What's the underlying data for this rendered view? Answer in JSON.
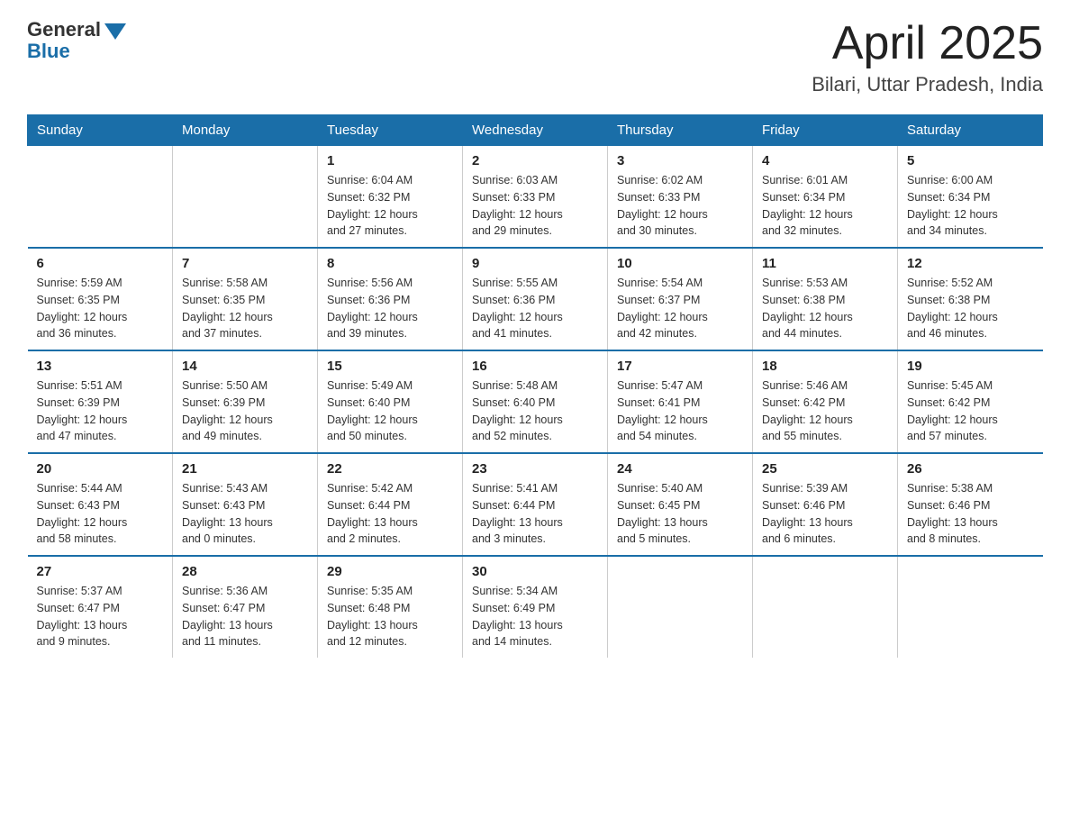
{
  "header": {
    "logo_general": "General",
    "logo_blue": "Blue",
    "title": "April 2025",
    "subtitle": "Bilari, Uttar Pradesh, India"
  },
  "days_of_week": [
    "Sunday",
    "Monday",
    "Tuesday",
    "Wednesday",
    "Thursday",
    "Friday",
    "Saturday"
  ],
  "weeks": [
    [
      {
        "day": "",
        "info": ""
      },
      {
        "day": "",
        "info": ""
      },
      {
        "day": "1",
        "info": "Sunrise: 6:04 AM\nSunset: 6:32 PM\nDaylight: 12 hours\nand 27 minutes."
      },
      {
        "day": "2",
        "info": "Sunrise: 6:03 AM\nSunset: 6:33 PM\nDaylight: 12 hours\nand 29 minutes."
      },
      {
        "day": "3",
        "info": "Sunrise: 6:02 AM\nSunset: 6:33 PM\nDaylight: 12 hours\nand 30 minutes."
      },
      {
        "day": "4",
        "info": "Sunrise: 6:01 AM\nSunset: 6:34 PM\nDaylight: 12 hours\nand 32 minutes."
      },
      {
        "day": "5",
        "info": "Sunrise: 6:00 AM\nSunset: 6:34 PM\nDaylight: 12 hours\nand 34 minutes."
      }
    ],
    [
      {
        "day": "6",
        "info": "Sunrise: 5:59 AM\nSunset: 6:35 PM\nDaylight: 12 hours\nand 36 minutes."
      },
      {
        "day": "7",
        "info": "Sunrise: 5:58 AM\nSunset: 6:35 PM\nDaylight: 12 hours\nand 37 minutes."
      },
      {
        "day": "8",
        "info": "Sunrise: 5:56 AM\nSunset: 6:36 PM\nDaylight: 12 hours\nand 39 minutes."
      },
      {
        "day": "9",
        "info": "Sunrise: 5:55 AM\nSunset: 6:36 PM\nDaylight: 12 hours\nand 41 minutes."
      },
      {
        "day": "10",
        "info": "Sunrise: 5:54 AM\nSunset: 6:37 PM\nDaylight: 12 hours\nand 42 minutes."
      },
      {
        "day": "11",
        "info": "Sunrise: 5:53 AM\nSunset: 6:38 PM\nDaylight: 12 hours\nand 44 minutes."
      },
      {
        "day": "12",
        "info": "Sunrise: 5:52 AM\nSunset: 6:38 PM\nDaylight: 12 hours\nand 46 minutes."
      }
    ],
    [
      {
        "day": "13",
        "info": "Sunrise: 5:51 AM\nSunset: 6:39 PM\nDaylight: 12 hours\nand 47 minutes."
      },
      {
        "day": "14",
        "info": "Sunrise: 5:50 AM\nSunset: 6:39 PM\nDaylight: 12 hours\nand 49 minutes."
      },
      {
        "day": "15",
        "info": "Sunrise: 5:49 AM\nSunset: 6:40 PM\nDaylight: 12 hours\nand 50 minutes."
      },
      {
        "day": "16",
        "info": "Sunrise: 5:48 AM\nSunset: 6:40 PM\nDaylight: 12 hours\nand 52 minutes."
      },
      {
        "day": "17",
        "info": "Sunrise: 5:47 AM\nSunset: 6:41 PM\nDaylight: 12 hours\nand 54 minutes."
      },
      {
        "day": "18",
        "info": "Sunrise: 5:46 AM\nSunset: 6:42 PM\nDaylight: 12 hours\nand 55 minutes."
      },
      {
        "day": "19",
        "info": "Sunrise: 5:45 AM\nSunset: 6:42 PM\nDaylight: 12 hours\nand 57 minutes."
      }
    ],
    [
      {
        "day": "20",
        "info": "Sunrise: 5:44 AM\nSunset: 6:43 PM\nDaylight: 12 hours\nand 58 minutes."
      },
      {
        "day": "21",
        "info": "Sunrise: 5:43 AM\nSunset: 6:43 PM\nDaylight: 13 hours\nand 0 minutes."
      },
      {
        "day": "22",
        "info": "Sunrise: 5:42 AM\nSunset: 6:44 PM\nDaylight: 13 hours\nand 2 minutes."
      },
      {
        "day": "23",
        "info": "Sunrise: 5:41 AM\nSunset: 6:44 PM\nDaylight: 13 hours\nand 3 minutes."
      },
      {
        "day": "24",
        "info": "Sunrise: 5:40 AM\nSunset: 6:45 PM\nDaylight: 13 hours\nand 5 minutes."
      },
      {
        "day": "25",
        "info": "Sunrise: 5:39 AM\nSunset: 6:46 PM\nDaylight: 13 hours\nand 6 minutes."
      },
      {
        "day": "26",
        "info": "Sunrise: 5:38 AM\nSunset: 6:46 PM\nDaylight: 13 hours\nand 8 minutes."
      }
    ],
    [
      {
        "day": "27",
        "info": "Sunrise: 5:37 AM\nSunset: 6:47 PM\nDaylight: 13 hours\nand 9 minutes."
      },
      {
        "day": "28",
        "info": "Sunrise: 5:36 AM\nSunset: 6:47 PM\nDaylight: 13 hours\nand 11 minutes."
      },
      {
        "day": "29",
        "info": "Sunrise: 5:35 AM\nSunset: 6:48 PM\nDaylight: 13 hours\nand 12 minutes."
      },
      {
        "day": "30",
        "info": "Sunrise: 5:34 AM\nSunset: 6:49 PM\nDaylight: 13 hours\nand 14 minutes."
      },
      {
        "day": "",
        "info": ""
      },
      {
        "day": "",
        "info": ""
      },
      {
        "day": "",
        "info": ""
      }
    ]
  ]
}
